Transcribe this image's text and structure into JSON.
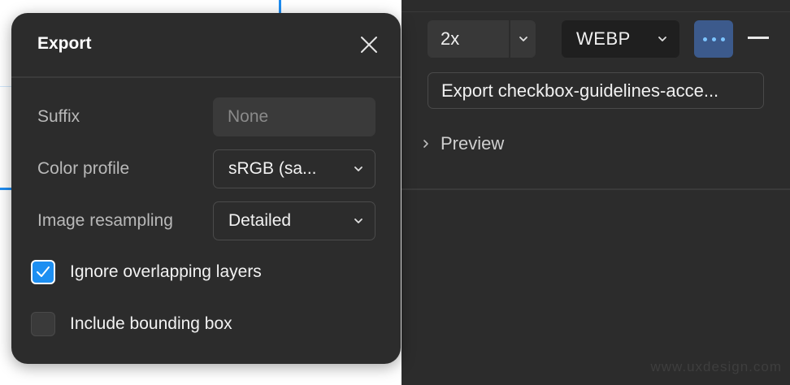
{
  "panel": {
    "scale": {
      "value": "2x"
    },
    "format": {
      "value": "WEBP"
    },
    "more_label": "•••",
    "export_button": "Export checkbox-guidelines-acce...",
    "preview_label": "Preview"
  },
  "modal": {
    "title": "Export",
    "rows": {
      "suffix": {
        "label": "Suffix",
        "placeholder": "None"
      },
      "color_profile": {
        "label": "Color profile",
        "value": "sRGB (sa..."
      },
      "image_resampling": {
        "label": "Image resampling",
        "value": "Detailed"
      }
    },
    "checkboxes": [
      {
        "label": "Ignore overlapping layers",
        "checked": true
      },
      {
        "label": "Include bounding box",
        "checked": false
      }
    ]
  },
  "watermark": "www.uxdesign.com",
  "colors": {
    "accent": "#1d8ff2",
    "panel_bg": "#2c2c2c",
    "guide": "#1e8cf0"
  },
  "icons": [
    "close-icon",
    "chevron-down-icon",
    "chevron-right-icon",
    "more-icon",
    "minus-icon",
    "checkmark-icon"
  ]
}
